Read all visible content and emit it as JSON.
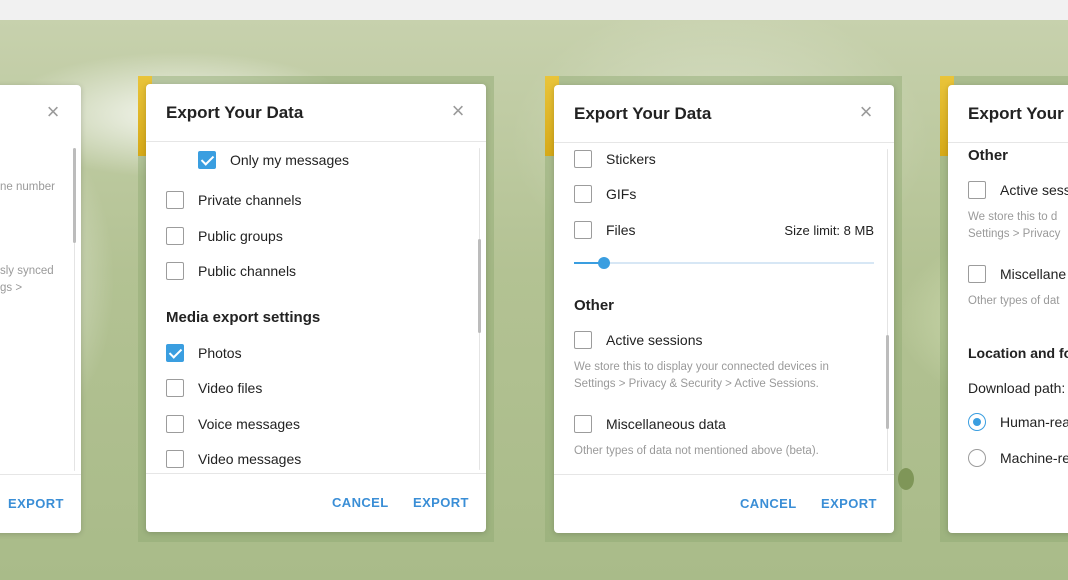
{
  "title": "Export Your Data",
  "buttons": {
    "cancel": "CANCEL",
    "export": "EXPORT"
  },
  "close_symbol": "×",
  "icons": {
    "close": "close-icon",
    "checkbox": "checkbox-icon",
    "radio": "radio-icon"
  },
  "colors": {
    "accent": "#3a9ee0",
    "link": "#3a8ed6"
  },
  "panel1": {
    "hint_fragment_1": "ne number",
    "hint_fragment_2a": "sly synced",
    "hint_fragment_2b": "gs >"
  },
  "panel2": {
    "only_my_messages": "Only my messages",
    "private_channels": "Private channels",
    "public_groups": "Public groups",
    "public_channels": "Public channels",
    "media_section": "Media export settings",
    "photos": "Photos",
    "video_files": "Video files",
    "voice_messages": "Voice messages",
    "video_messages": "Video messages"
  },
  "panel3": {
    "stickers": "Stickers",
    "gifs": "GIFs",
    "files": "Files",
    "size_limit": "Size limit: 8 MB",
    "size_limit_mb": 8,
    "slider_fraction": 0.1,
    "other_section": "Other",
    "active_sessions": "Active sessions",
    "active_sessions_hint": "We store this to display your connected devices in Settings > Privacy & Security > Active Sessions.",
    "misc_data": "Miscellaneous data",
    "misc_hint": "Other types of data not mentioned above (beta)."
  },
  "panel4": {
    "title": "Export Your",
    "other_section": "Other",
    "active_sessions": "Active sess",
    "hint_1a": "We store this to d",
    "hint_1b": "Settings > Privacy",
    "misc_data": "Miscellane",
    "misc_hint": "Other types of dat",
    "location_section": "Location and fo",
    "download_path": "Download path:",
    "human_readable": "Human-rea",
    "machine_readable": "Machine-re"
  }
}
